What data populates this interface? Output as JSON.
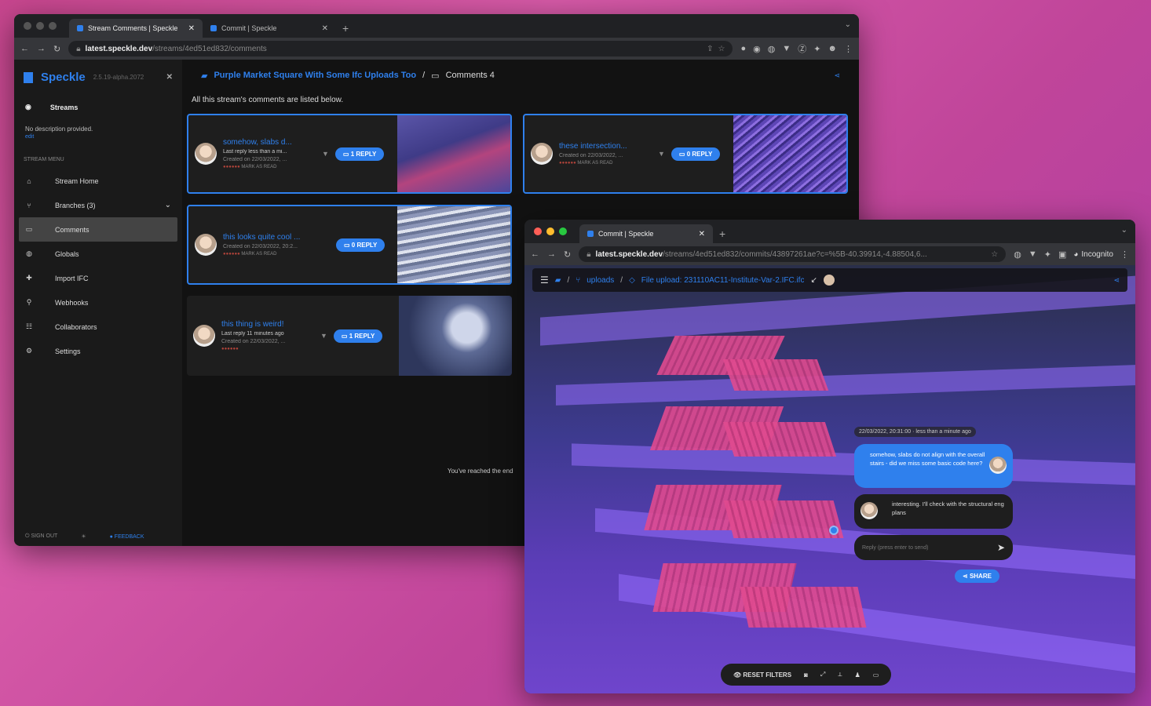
{
  "win1": {
    "tabs": [
      {
        "label": "Stream Comments | Speckle"
      },
      {
        "label": "Commit | Speckle"
      }
    ],
    "url_host": "latest.speckle.dev",
    "url_path": "/streams/4ed51ed832/comments",
    "sidebar": {
      "brand": "Speckle",
      "version": "2.5.19-alpha.2072",
      "streams_label": "Streams",
      "description": "No description provided.",
      "edit": "edit",
      "menu_header": "STREAM MENU",
      "items": [
        {
          "label": "Stream Home",
          "icon": "home-icon"
        },
        {
          "label": "Branches (3)",
          "icon": "branch-icon"
        },
        {
          "label": "Comments",
          "icon": "comment-icon"
        },
        {
          "label": "Globals",
          "icon": "globe-icon"
        },
        {
          "label": "Import IFC",
          "icon": "import-icon"
        },
        {
          "label": "Webhooks",
          "icon": "webhook-icon"
        },
        {
          "label": "Collaborators",
          "icon": "people-icon"
        },
        {
          "label": "Settings",
          "icon": "gear-icon"
        }
      ],
      "sign_out": "SIGN OUT",
      "feedback": "FEEDBACK"
    },
    "breadcrumb": {
      "stream": "Purple Market Square With Some Ifc Uploads Too",
      "page": "Comments 4"
    },
    "listed": "All this stream's comments are listed below.",
    "comments": [
      {
        "title": "somehow, slabs d...",
        "line1": "Last reply less than a mi...",
        "line2": "Created on 22/03/2022, ...",
        "mark": "MARK AS READ",
        "reply": "1 REPLY"
      },
      {
        "title": "these intersection...",
        "line1": "Created on 22/03/2022, ...",
        "line2": "",
        "mark": "MARK AS READ",
        "reply": "0 REPLY"
      },
      {
        "title": "this looks quite cool ...",
        "line1": "Created on 22/03/2022, 20:2...",
        "line2": "",
        "mark": "MARK AS READ",
        "reply": "0 REPLY"
      },
      {
        "title": "this thing is weird!",
        "line1": "Last reply 11 minutes ago",
        "line2": "Created on 22/03/2022, ...",
        "mark": "",
        "reply": "1 REPLY"
      }
    ],
    "reached": "You've reached the end"
  },
  "win2": {
    "tab": "Commit | Speckle",
    "url_host": "latest.speckle.dev",
    "url_path": "/streams/4ed51ed832/commits/43897261ae?c=%5B-40.39914,-4.88504,6...",
    "incognito": "Incognito",
    "crumb_branch": "uploads",
    "crumb_commit": "File upload: 231110AC11-Institute-Var-2.IFC.ifc",
    "timestamp": "22/03/2022, 20:31:00 · less than a minute ago",
    "msg_me": "somehow, slabs do not align with the overall stairs - did we miss some basic code here?",
    "msg_other": "interesting. I'll check with the structural eng plans",
    "reply_placeholder": "Reply (press enter to send)",
    "share": "SHARE",
    "reset_filters": "RESET FILTERS"
  },
  "colors": {
    "accent": "#2f80ed",
    "dark": "#1e1e1e",
    "stairs": "#e04a8f",
    "slab": "#7b57e0"
  }
}
